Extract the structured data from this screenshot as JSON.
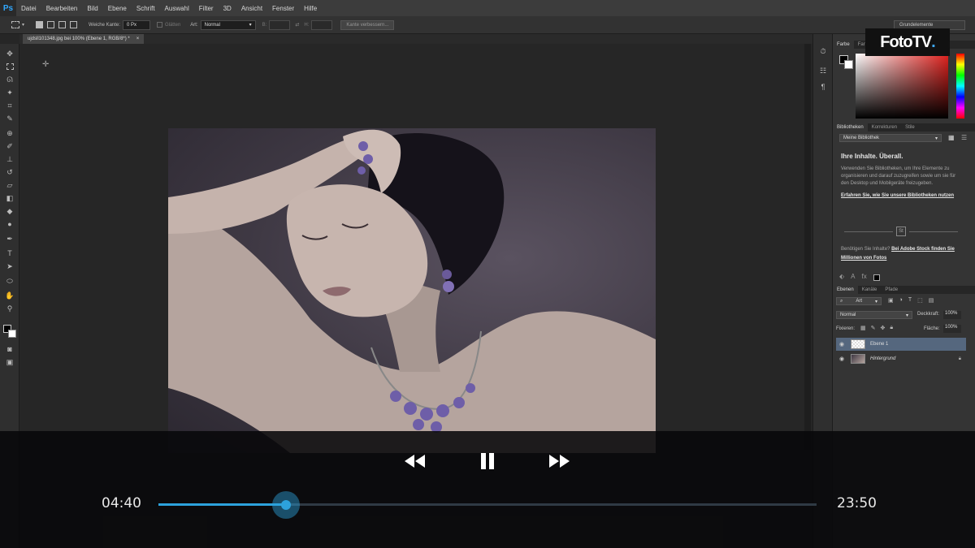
{
  "app": {
    "logo": "Ps"
  },
  "menu": [
    "Datei",
    "Bearbeiten",
    "Bild",
    "Ebene",
    "Schrift",
    "Auswahl",
    "Filter",
    "3D",
    "Ansicht",
    "Fenster",
    "Hilfe"
  ],
  "options": {
    "feather_label": "Weiche Kante:",
    "feather_value": "0 Px",
    "antialias_label": "Glätten",
    "style_label": "Art:",
    "style_value": "Normal",
    "width_label": "B:",
    "height_label": "H:",
    "refine_button": "Kante verbessern...",
    "workspace": "Grundelemente"
  },
  "document": {
    "tab": "ujdsll101348.jpg bei 100% (Ebene 1, RGB/8*) *"
  },
  "panels": {
    "color_tabs": [
      "Farbe",
      "Farbf"
    ],
    "library_tabs": [
      "Bibliotheken",
      "Korrekturen",
      "Stile"
    ],
    "library_select": "Meine Bibliothek",
    "library_title": "Ihre Inhalte. Überall.",
    "library_text": "Verwenden Sie Bibliotheken, um Ihre Elemente zu organisieren und darauf zuzugreifen sowie um sie für den Desktop und Mobilgeräte freizugeben.",
    "library_link": "Erfahren Sie, wie Sie unsere Bibliotheken nutzen",
    "stock_prompt": "Benötigen Sie Inhalte?",
    "stock_link": "Bei Adobe Stock finden Sie Millionen von Fotos",
    "layers_tabs": [
      "Ebenen",
      "Kanäle",
      "Pfade"
    ],
    "layer_filter": "Art",
    "blend_mode": "Normal",
    "opacity_label": "Deckkraft:",
    "opacity_value": "100%",
    "lock_label": "Fixieren:",
    "fill_label": "Fläche:",
    "fill_value": "100%",
    "layers": [
      {
        "name": "Ebene 1",
        "selected": true
      },
      {
        "name": "Hintergrund",
        "selected": false
      }
    ]
  },
  "watermark": {
    "text": "FotoTV",
    "dot": "."
  },
  "player": {
    "elapsed": "04:40",
    "total": "23:50",
    "progress": 0.194,
    "accent": "#2da2dc"
  }
}
